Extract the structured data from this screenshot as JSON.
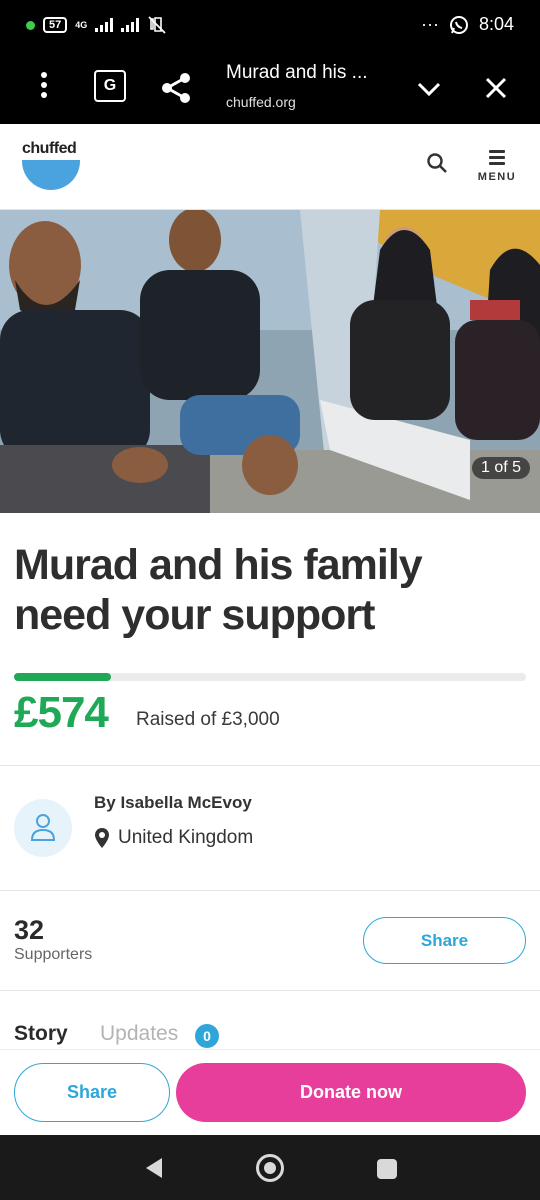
{
  "status_bar": {
    "battery": "57",
    "network": "4G",
    "time": "8:04",
    "more": "···"
  },
  "browser_bar": {
    "title": "Murad and his ...",
    "url": "chuffed.org",
    "translate_glyph": "G"
  },
  "site_header": {
    "logo_text": "chuffed",
    "menu_label": "MENU",
    "brand_color": "#4aa3df"
  },
  "hero": {
    "photo_counter": "1 of 5"
  },
  "campaign": {
    "title": "Murad and his family need your support",
    "raised": "£574",
    "raised_of": "Raised of £3,000",
    "progress_fraction": 0.19,
    "progress_color": "#1fa855"
  },
  "organiser": {
    "name": "By Isabella McEvoy",
    "location": "United Kingdom"
  },
  "supporters": {
    "count": "32",
    "label": "Supporters",
    "share_label": "Share"
  },
  "tabs": {
    "story": "Story",
    "updates": "Updates",
    "updates_count": "0"
  },
  "footer": {
    "share_label": "Share",
    "donate_label": "Donate now",
    "donate_color": "#e83e9b",
    "accent_color": "#2fa6d9"
  },
  "icons": {
    "status": [
      "signal-icon",
      "mute-icon",
      "whatsapp-icon"
    ],
    "browser": [
      "kebab-menu-icon",
      "translate-icon",
      "share-icon",
      "chevron-down-icon",
      "close-icon"
    ],
    "header": [
      "search-icon",
      "hamburger-menu-icon"
    ],
    "nav": [
      "back-icon",
      "home-icon",
      "recents-icon"
    ]
  }
}
